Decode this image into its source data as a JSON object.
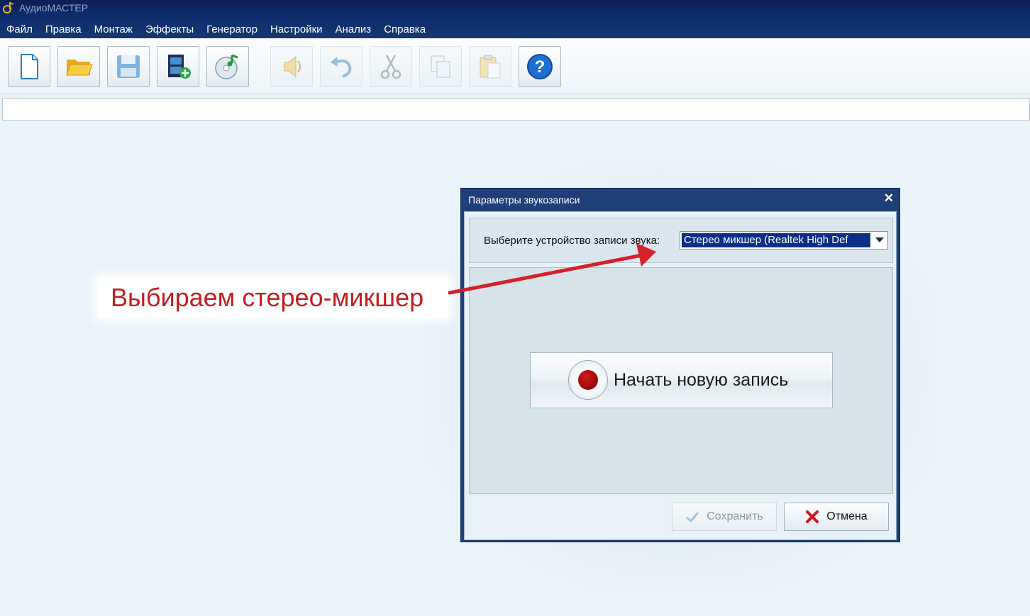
{
  "window": {
    "title": "АудиоМАСТЕР"
  },
  "menu": [
    "Файл",
    "Правка",
    "Монтаж",
    "Эффекты",
    "Генератор",
    "Настройки",
    "Анализ",
    "Справка"
  ],
  "toolbar": {
    "buttons": [
      {
        "icon": "new-file-icon",
        "enabled": true
      },
      {
        "icon": "open-folder-icon",
        "enabled": true
      },
      {
        "icon": "save-disk-icon",
        "enabled": true
      },
      {
        "icon": "video-add-icon",
        "enabled": true
      },
      {
        "icon": "cd-music-icon",
        "enabled": true
      },
      {
        "icon": "speaker-icon",
        "enabled": false
      },
      {
        "icon": "undo-icon",
        "enabled": false
      },
      {
        "icon": "cut-icon",
        "enabled": false
      },
      {
        "icon": "copy-icon",
        "enabled": false
      },
      {
        "icon": "paste-icon",
        "enabled": false
      },
      {
        "icon": "help-icon",
        "enabled": true
      }
    ]
  },
  "annotation": {
    "text": "Выбираем стерео-микшер",
    "color": "#c41e1e"
  },
  "dialog": {
    "title": "Параметры звукозаписи",
    "close_glyph": "✕",
    "device_label": "Выберите устройство записи звука:",
    "device_value": "Стерео микшер (Realtek High Def",
    "record_button": "Начать новую запись",
    "save_button": "Сохранить",
    "cancel_button": "Отмена",
    "save_enabled": false
  },
  "colors": {
    "titlebar": "#0f2d6e",
    "accent_selection": "#0c2f86",
    "record_red": "#b00e0e"
  }
}
